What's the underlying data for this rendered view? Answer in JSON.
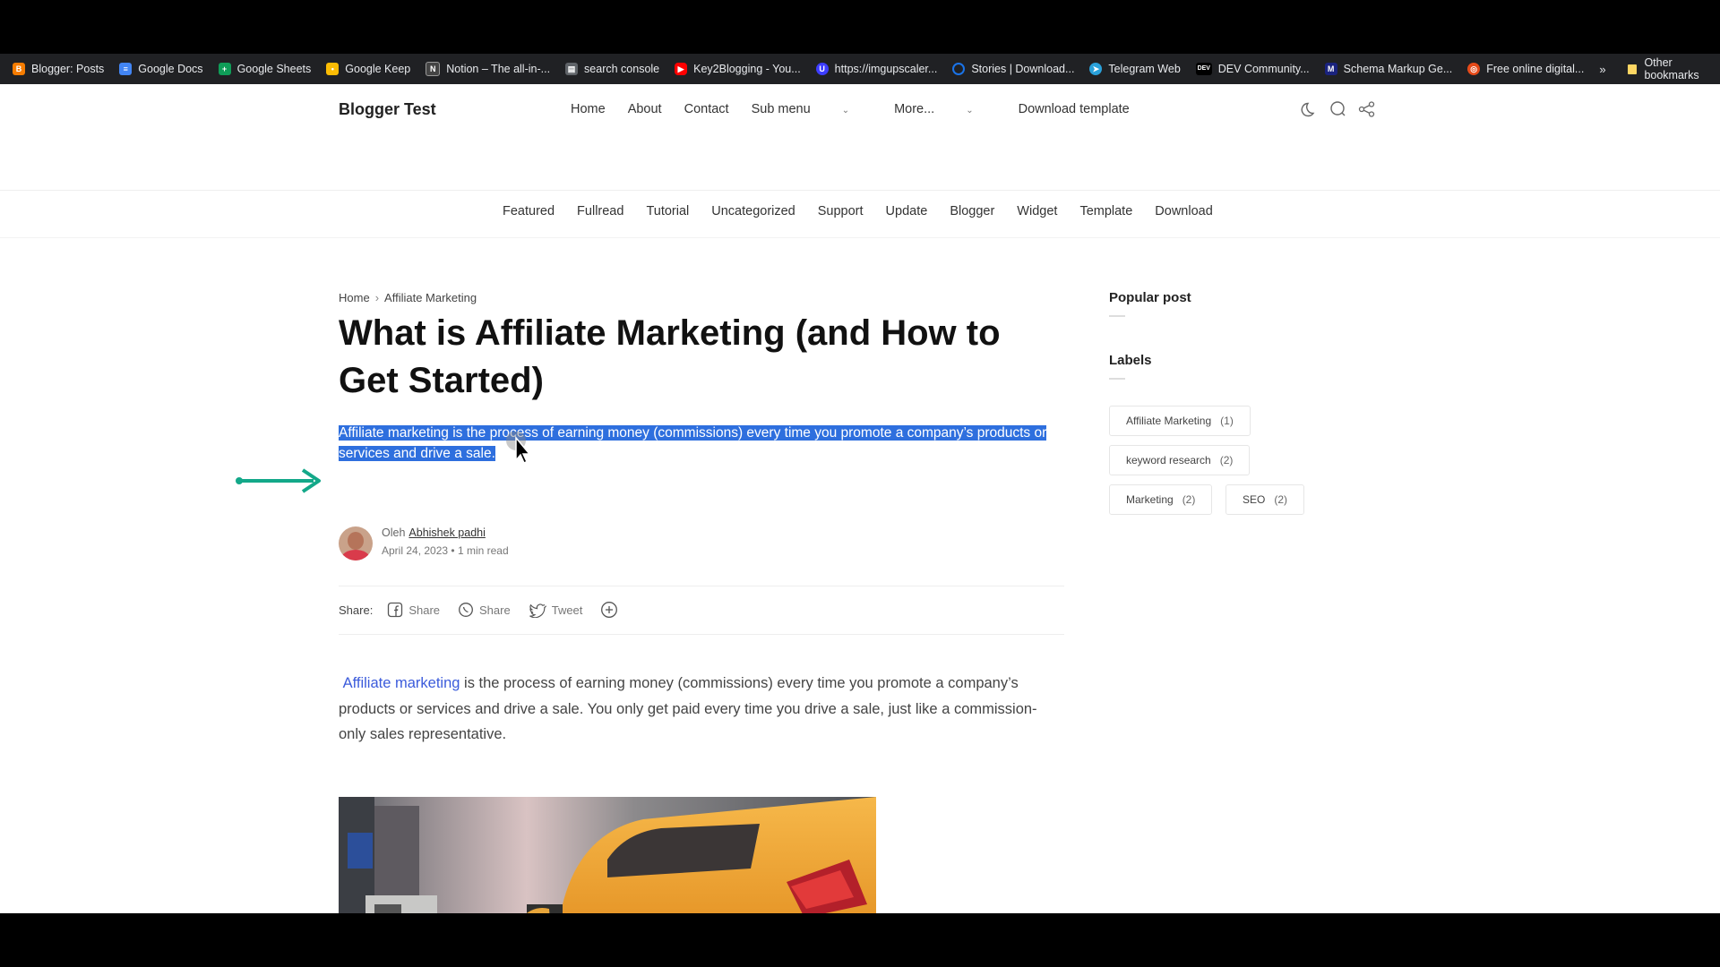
{
  "bookmarks": [
    {
      "label": "Blogger: Posts",
      "color": "#f57c00",
      "icon": "blogger-icon"
    },
    {
      "label": "Google Docs",
      "color": "#4285f4",
      "icon": "docs-icon"
    },
    {
      "label": "Google Sheets",
      "color": "#0f9d58",
      "icon": "sheets-icon"
    },
    {
      "label": "Google Keep",
      "color": "#fbbc04",
      "icon": "keep-icon"
    },
    {
      "label": "Notion – The all-in-...",
      "color": "#444444",
      "icon": "notion-icon"
    },
    {
      "label": "search console",
      "color": "#5f6368",
      "icon": "search-console-icon"
    },
    {
      "label": "Key2Blogging - You...",
      "color": "#ff0000",
      "icon": "youtube-icon"
    },
    {
      "label": "https://imgupscaler...",
      "color": "#3d3dff",
      "icon": "imgupscaler-icon"
    },
    {
      "label": "Stories | Download...",
      "color": "#1a73e8",
      "icon": "stories-icon"
    },
    {
      "label": "Telegram Web",
      "color": "#2aa1da",
      "icon": "telegram-icon"
    },
    {
      "label": "DEV Community...",
      "color": "#000000",
      "icon": "dev-icon"
    },
    {
      "label": "Schema Markup Ge...",
      "color": "#1a237e",
      "icon": "schema-icon"
    },
    {
      "label": "Free online digital...",
      "color": "#e64a19",
      "icon": "digital-icon"
    }
  ],
  "bookmarks_more": "»",
  "other_bookmarks": "Other bookmarks",
  "site": {
    "brand": "Blogger Test",
    "nav": [
      "Home",
      "About",
      "Contact",
      "Sub menu",
      "More...",
      "Download template"
    ],
    "subnav": [
      "Featured",
      "Fullread",
      "Tutorial",
      "Uncategorized",
      "Support",
      "Update",
      "Blogger",
      "Widget",
      "Template",
      "Download"
    ]
  },
  "article": {
    "breadcrumb": [
      "Home",
      "Affiliate Marketing"
    ],
    "title": "What is Affiliate Marketing (and How to Get Started)",
    "snippet": "Affiliate marketing is the process of earning money (commissions) every time you promote a company’s products or services and drive a sale.",
    "author_prefix": "Oleh",
    "author": "Abhishek padhi",
    "date": "April 24, 2023",
    "read_time": "1 min read",
    "share_label": "Share:",
    "share": [
      "Share",
      "Share",
      "Tweet"
    ],
    "body_link": "Affiliate marketing",
    "body_rest": " is the process of earning money (commissions) every time you promote a company’s products or services and drive a sale. You only get paid every time you drive a sale, just like a commission-only sales representative."
  },
  "sidebar": {
    "popular": "Popular post",
    "labels": "Labels",
    "tags": [
      {
        "name": "Affiliate Marketing",
        "count": "(1)"
      },
      {
        "name": "keyword research",
        "count": "(2)"
      },
      {
        "name": "Marketing",
        "count": "(2)"
      },
      {
        "name": "SEO",
        "count": "(2)"
      }
    ]
  },
  "colors": {
    "highlight": "#2e6fde",
    "arrow": "#13a889",
    "link": "#3b5bdb"
  }
}
